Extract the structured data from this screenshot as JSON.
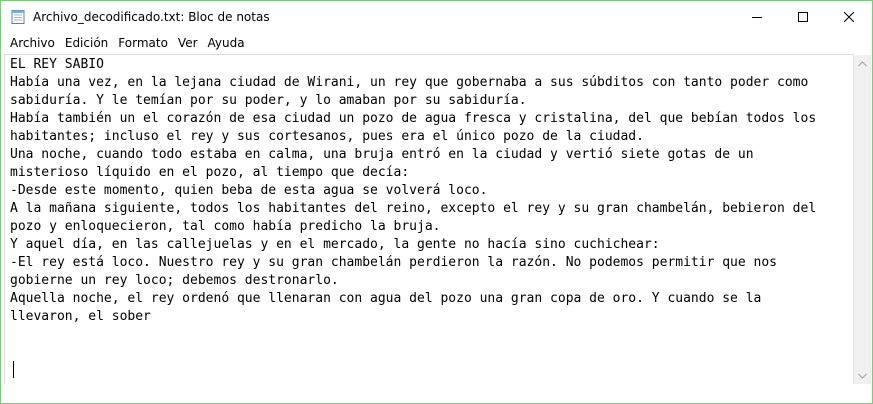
{
  "window": {
    "title": "Archivo_decodificado.txt: Bloc de notas",
    "app_icon": "notepad-icon",
    "controls": {
      "minimize_icon": "minimize-icon",
      "maximize_icon": "maximize-icon",
      "close_icon": "close-icon"
    }
  },
  "menubar": {
    "items": [
      "Archivo",
      "Edición",
      "Formato",
      "Ver",
      "Ayuda"
    ]
  },
  "editor": {
    "lines": [
      "EL REY SABIO",
      "Había una vez, en la lejana ciudad de Wirani, un rey que gobernaba a sus súbditos con tanto poder como",
      "sabiduría. Y le temían por su poder, y lo amaban por su sabiduría.",
      "Había también un el corazón de esa ciudad un pozo de agua fresca y cristalina, del que bebían todos los",
      "habitantes; incluso el rey y sus cortesanos, pues era el único pozo de la ciudad.",
      "Una noche, cuando todo estaba en calma, una bruja entró en la ciudad y vertió siete gotas de un",
      "misterioso líquido en el pozo, al tiempo que decía:",
      "-Desde este momento, quien beba de esta agua se volverá loco.",
      "A la mañana siguiente, todos los habitantes del reino, excepto el rey y su gran chambelán, bebieron del",
      "pozo y enloquecieron, tal como había predicho la bruja.",
      "Y aquel día, en las callejuelas y en el mercado, la gente no hacía sino cuchichear:",
      "-El rey está loco. Nuestro rey y su gran chambelán perdieron la razón. No podemos permitir que nos",
      "gobierne un rey loco; debemos destronarlo.",
      "Aquella noche, el rey ordenó que llenaran con agua del pozo una gran copa de oro. Y cuando se la",
      "llevaron, el sober"
    ]
  }
}
